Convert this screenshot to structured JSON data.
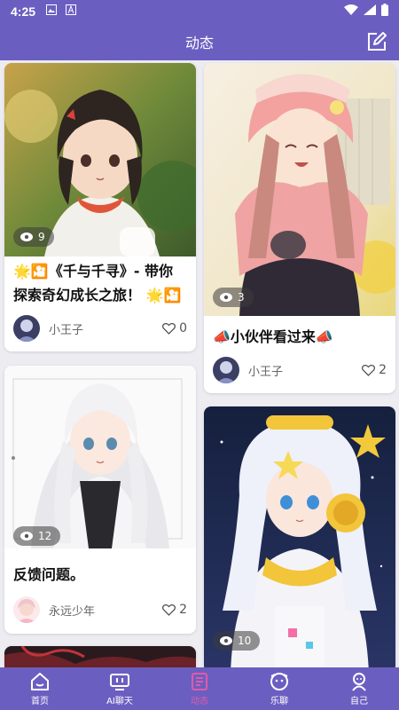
{
  "status": {
    "time": "4:25"
  },
  "header": {
    "title": "动态"
  },
  "cards": [
    {
      "title": "🌟🎦《千与千寻》- 带你探索奇幻成长之旅！ 🌟🎦",
      "views": "9",
      "author": "小王子",
      "likes": "0"
    },
    {
      "title": "📣小伙伴看过来📣",
      "views": "3",
      "author": "小王子",
      "likes": "2"
    },
    {
      "title": "反馈问题。",
      "views": "12",
      "author": "永远少年",
      "likes": "2"
    },
    {
      "title": "",
      "views": "10",
      "author": "",
      "likes": ""
    }
  ],
  "nav": [
    {
      "label": "首页",
      "icon": "home-icon"
    },
    {
      "label": "AI聊天",
      "icon": "tv-icon"
    },
    {
      "label": "动态",
      "icon": "feed-icon"
    },
    {
      "label": "乐聊",
      "icon": "chat-face-icon"
    },
    {
      "label": "自己",
      "icon": "profile-icon"
    }
  ],
  "colors": {
    "primary": "#6a5fc1",
    "active_nav": "#e35aa8",
    "background": "#ececf1"
  }
}
